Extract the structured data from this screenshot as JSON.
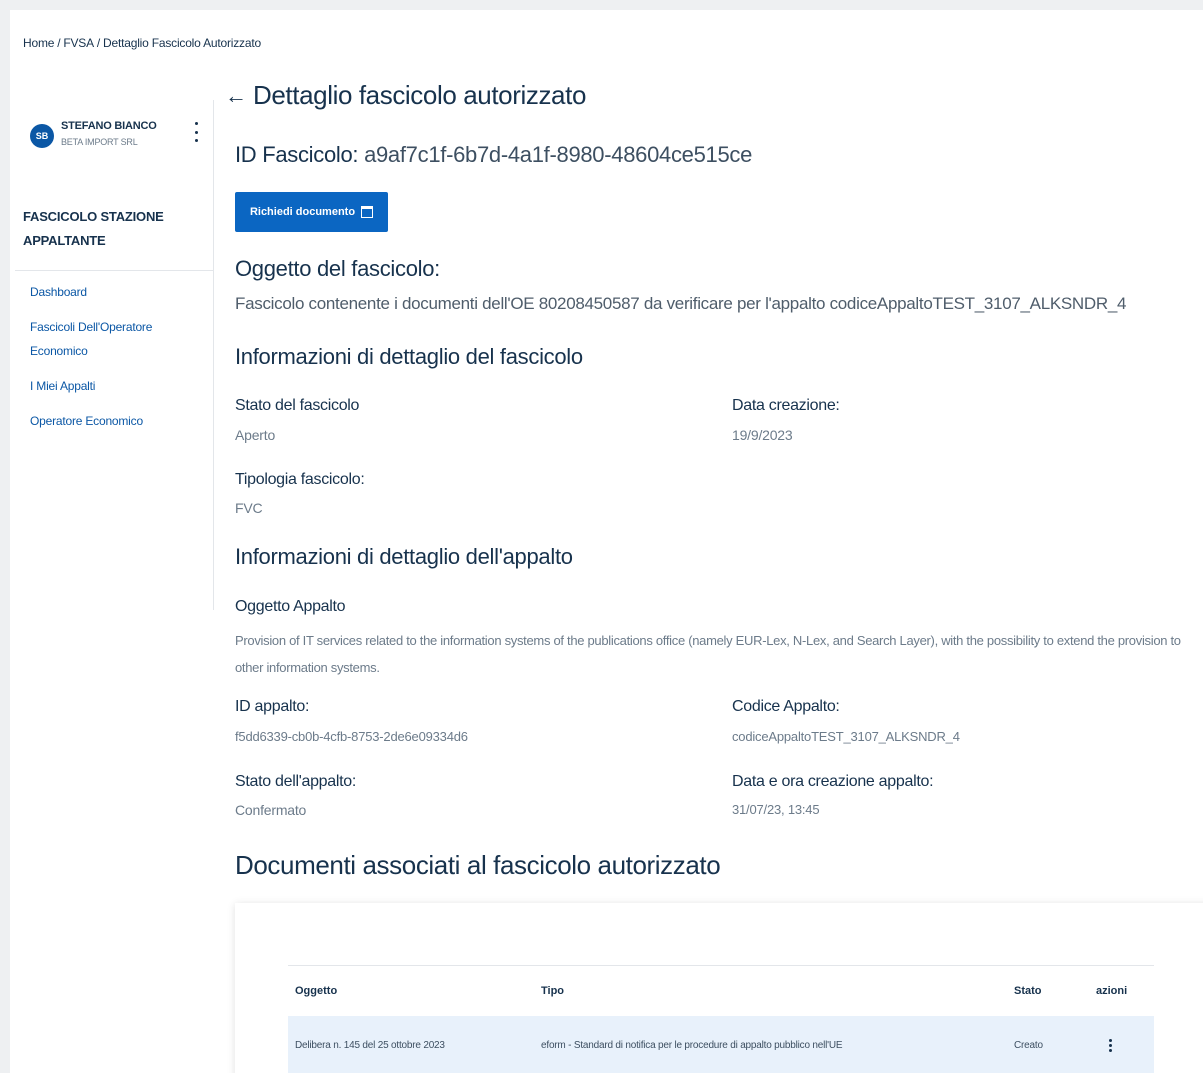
{
  "breadcrumb": [
    "Home",
    "FVSA",
    "Dettaglio Fascicolo Autorizzato"
  ],
  "breadcrumb_separator": "/",
  "user": {
    "initials": "SB",
    "name": "STEFANO BIANCO",
    "company": "BETA IMPORT SRL"
  },
  "sidebar": {
    "section_title": "FASCICOLO STAZIONE APPALTANTE",
    "items": [
      {
        "label": "Dashboard"
      },
      {
        "label": "Fascicoli Dell'Operatore Economico"
      },
      {
        "label": "I Miei Appalti"
      },
      {
        "label": "Operatore Economico"
      }
    ]
  },
  "main": {
    "title": "Dettaglio fascicolo autorizzato",
    "id_label": "ID Fascicolo:",
    "id_value": "a9af7c1f-6b7d-4a1f-8980-48604ce515ce",
    "request_button": "Richiedi documento",
    "oggetto_heading": "Oggetto del fascicolo:",
    "oggetto_text": "Fascicolo contenente i documenti dell'OE 80208450587 da verificare per l'appalto codiceAppaltoTEST_3107_ALKSNDR_4",
    "fascicolo_heading": "Informazioni di dettaglio del fascicolo",
    "stato_fascicolo_label": "Stato del fascicolo",
    "stato_fascicolo_value": "Aperto",
    "data_creazione_label": "Data creazione:",
    "data_creazione_value": "19/9/2023",
    "tipologia_label": "Tipologia fascicolo:",
    "tipologia_value": "FVC",
    "appalto_heading": "Informazioni di dettaglio dell'appalto",
    "oggetto_appalto_label": "Oggetto Appalto",
    "oggetto_appalto_value": "Provision of IT services related to the information systems of the publications office (namely EUR-Lex, N-Lex, and Search Layer), with the possibility to extend the provision to other information systems.",
    "id_appalto_label": "ID appalto:",
    "id_appalto_value": "f5dd6339-cb0b-4cfb-8753-2de6e09334d6",
    "codice_appalto_label": "Codice Appalto:",
    "codice_appalto_value": "codiceAppaltoTEST_3107_ALKSNDR_4",
    "stato_appalto_label": "Stato dell'appalto:",
    "stato_appalto_value": "Confermato",
    "data_ora_label": "Data e ora creazione appalto:",
    "data_ora_value": "31/07/23, 13:45",
    "documenti_heading": "Documenti associati al fascicolo autorizzato"
  },
  "table": {
    "headers": [
      "Oggetto",
      "Tipo",
      "Stato",
      "azioni"
    ],
    "rows": [
      [
        "Delibera n. 145 del 25 ottobre 2023",
        "eform - Standard di notifica per le procedure di appalto pubblico nell'UE",
        "Creato"
      ]
    ]
  },
  "colors": {
    "primary": "#0b66c2",
    "text": "#17324d",
    "muted": "#6c7b8a",
    "row_highlight": "#e8f1fb"
  },
  "icons": [
    "back-arrow-icon",
    "kebab-menu-icon",
    "document-icon"
  ]
}
